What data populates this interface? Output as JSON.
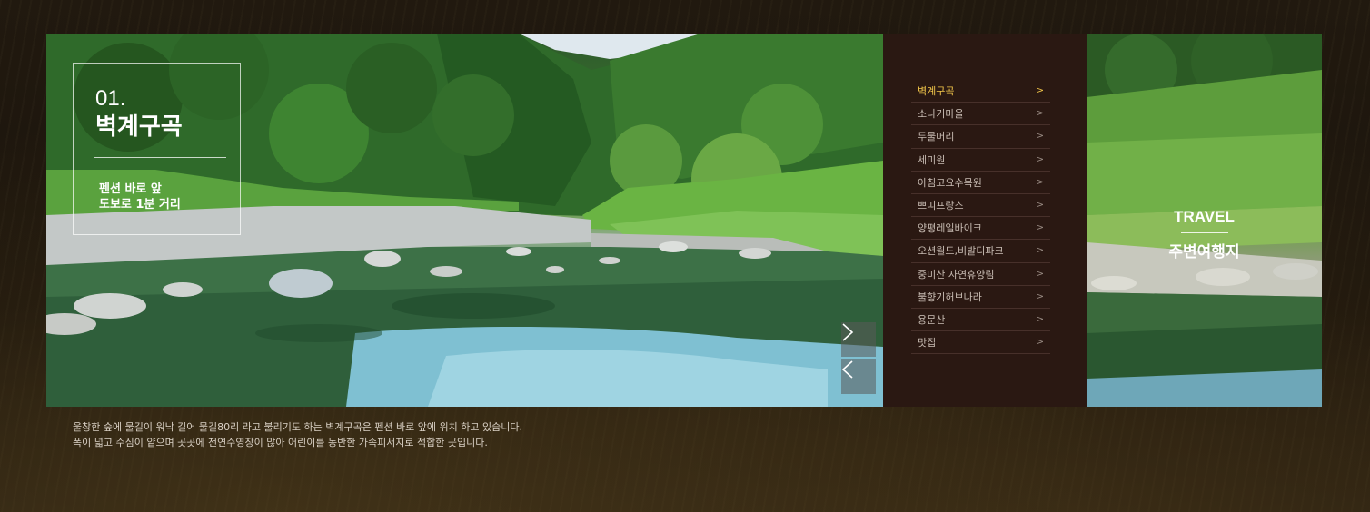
{
  "feature": {
    "number": "01.",
    "title": "벽계구곡",
    "subtitle_line1": "펜션 바로 앞",
    "subtitle_line2": "도보로 1분 거리"
  },
  "controls": {
    "next_icon": "chevron-right-icon",
    "prev_icon": "chevron-left-icon"
  },
  "nav": {
    "active_index": 0,
    "items": [
      "벽계구곡",
      "소나기마을",
      "두물머리",
      "세미원",
      "아침고요수목원",
      "쁘띠프랑스",
      "양평레일바이크",
      "오션월드,비발디파크",
      "중미산 자연휴양림",
      "불향기허브나라",
      "용문산",
      "맛집"
    ],
    "chevron": ">"
  },
  "travel": {
    "title_en": "TRAVEL",
    "title_ko": "주변여행지"
  },
  "description": {
    "line1": "울창한 숲에 물길이 워낙 길어 물길80리 라고 불리기도 하는 벽계구곡은 펜션 바로 앞에 위치 하고 있습니다.",
    "line2": "폭이 넓고 수심이 얕으며 곳곳에 천연수영장이 많아 어린이를 동반한 가족피서지로 적합한 곳입니다."
  },
  "colors": {
    "accent": "#f2c64a",
    "nav_bg": "#2a1812",
    "page_bg": "#1e160d"
  }
}
